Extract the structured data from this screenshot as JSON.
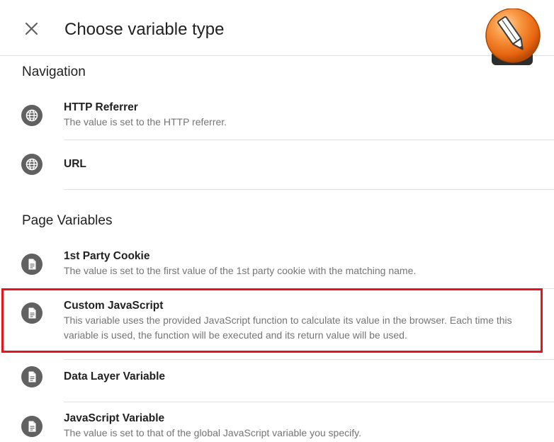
{
  "header": {
    "title": "Choose variable type",
    "close_icon": "close-icon",
    "logo_icon": "pencil-logo-icon"
  },
  "sections": [
    {
      "title": "Navigation",
      "items": [
        {
          "name": "HTTP Referrer",
          "description": "The value is set to the HTTP referrer.",
          "icon": "globe-icon"
        },
        {
          "name": "URL",
          "description": "",
          "icon": "globe-icon"
        }
      ]
    },
    {
      "title": "Page Variables",
      "items": [
        {
          "name": "1st Party Cookie",
          "description": "The value is set to the first value of the 1st party cookie with the matching name.",
          "icon": "document-icon"
        },
        {
          "name": "Custom JavaScript",
          "description": "This variable uses the provided JavaScript function to calculate its value in the browser. Each time this variable is used, the function will be executed and its return value will be used.",
          "icon": "document-icon"
        },
        {
          "name": "Data Layer Variable",
          "description": "",
          "icon": "document-icon"
        },
        {
          "name": "JavaScript Variable",
          "description": "The value is set to that of the global JavaScript variable you specify.",
          "icon": "document-icon"
        }
      ]
    }
  ],
  "colors": {
    "highlight": "#e8141c",
    "icon_bg": "#616161",
    "logo_orange": "#f07a1e",
    "divider": "#e0e0e0"
  }
}
